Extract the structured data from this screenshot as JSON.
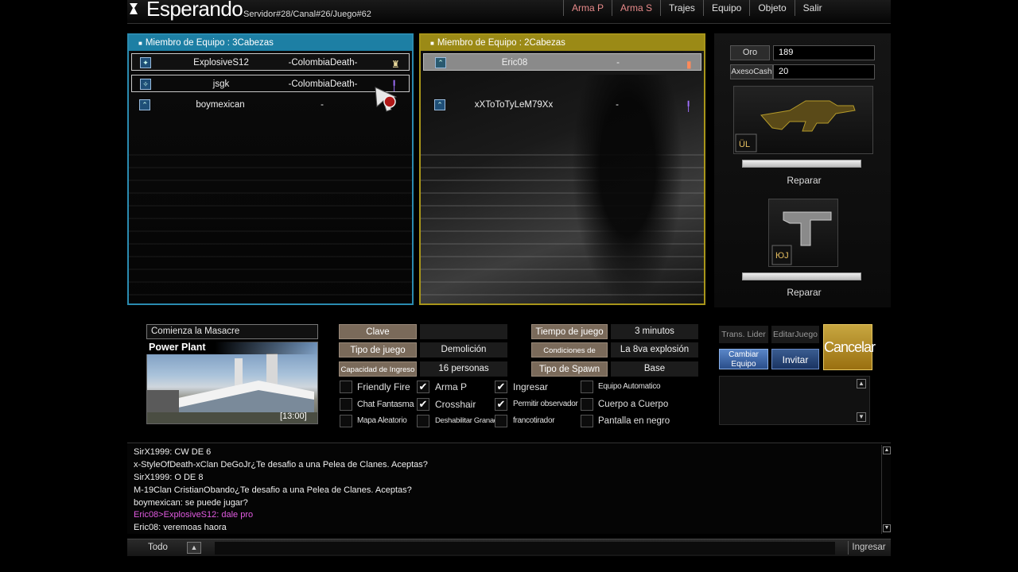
{
  "header": {
    "status_title": "Esperando",
    "server_info": "Servidor#28/Canal#26/Juego#62",
    "menu": [
      "Arma P",
      "Arma S",
      "Trajes",
      "Equipo",
      "Objeto",
      "Salir"
    ]
  },
  "team_a": {
    "header": "Miembro de Equipo : 3Cabezas",
    "players": [
      {
        "name": "ExplosiveS12",
        "clan": "-ColombiaDeath-"
      },
      {
        "name": "jsgk",
        "clan": "-ColombiaDeath-"
      },
      {
        "name": "boymexican",
        "clan": "-"
      }
    ]
  },
  "team_b": {
    "header": "Miembro de Equipo : 2Cabezas",
    "players": [
      {
        "name": "Eric08",
        "clan": "-"
      },
      {
        "name": "xXToToTyLeM79Xx",
        "clan": "-"
      }
    ]
  },
  "currency": {
    "gold_label": "Oro",
    "gold_value": "189",
    "cash_label": "AxesoCash",
    "cash_value": "20"
  },
  "weapons": {
    "primary_repair": "Reparar",
    "secondary_repair": "Reparar",
    "primary_durability": 1.0,
    "secondary_durability": 1.0
  },
  "room": {
    "mode_name": "Comienza la Masacre",
    "map_name": "Power Plant",
    "map_time": "[13:00]",
    "clave_label": "Clave",
    "clave_value": "",
    "tipo_label": "Tipo de juego",
    "tipo_value": "Demolición",
    "capacidad_label": "Capacidad de Ingreso",
    "capacidad_value": "16 personas",
    "tiempo_label": "Tiempo de juego",
    "tiempo_value": "3 minutos",
    "condiciones_label": "Condiciones de Victoria",
    "condiciones_value": "La 8va explosión",
    "spawn_label": "Tipo de Spawn",
    "spawn_value": "Base"
  },
  "options": {
    "friendly_fire": "Friendly Fire",
    "arma_p": "Arma P",
    "ingresar": "Ingresar",
    "equipo_automatico": "Equipo Automatico",
    "chat_fantasma": "Chat Fantasma",
    "crosshair": "Crosshair",
    "permitir_observador": "Permitir observador",
    "cuerpo_a_cuerpo": "Cuerpo a Cuerpo",
    "mapa_aleatorio": "Mapa Aleatorio",
    "deshabilitar_granada": "Deshabilitar Granad",
    "francotirador": "francotirador",
    "pantalla_en_negro": "Pantalla en negro"
  },
  "actions": {
    "trans_lider": "Trans. Lider",
    "editar_juego": "EditarJuego",
    "cambiar_equipo": "Cambiar Equipo",
    "invitar": "Invitar",
    "cancelar": "Cancelar"
  },
  "chat": {
    "lines": [
      {
        "text": "SirX1999: CW DE 6",
        "color": "#f0f0f0"
      },
      {
        "text": "x-StyleOfDeath-xClan DeGoJr¿Te desafio a una Pelea de Clanes. Aceptas?",
        "color": "#f0f0f0"
      },
      {
        "text": "SirX1999: O DE 8",
        "color": "#f0f0f0"
      },
      {
        "text": "M-19Clan CristianObando¿Te desafio a una Pelea de Clanes. Aceptas?",
        "color": "#f0f0f0"
      },
      {
        "text": "boymexican: se puede jugar?",
        "color": "#f0f0f0"
      },
      {
        "text": "Eric08>ExplosiveS12: dale pro",
        "color": "#e25be2"
      },
      {
        "text": "Eric08: veremoas haora",
        "color": "#f0f0f0"
      }
    ],
    "channel": "Todo",
    "enter_label": "Ingresar"
  },
  "colors": {
    "team_a": "#1d7fa4",
    "team_b": "#9b8a16",
    "whisper": "#e25be2",
    "menu_accent": "#e88a8a"
  }
}
